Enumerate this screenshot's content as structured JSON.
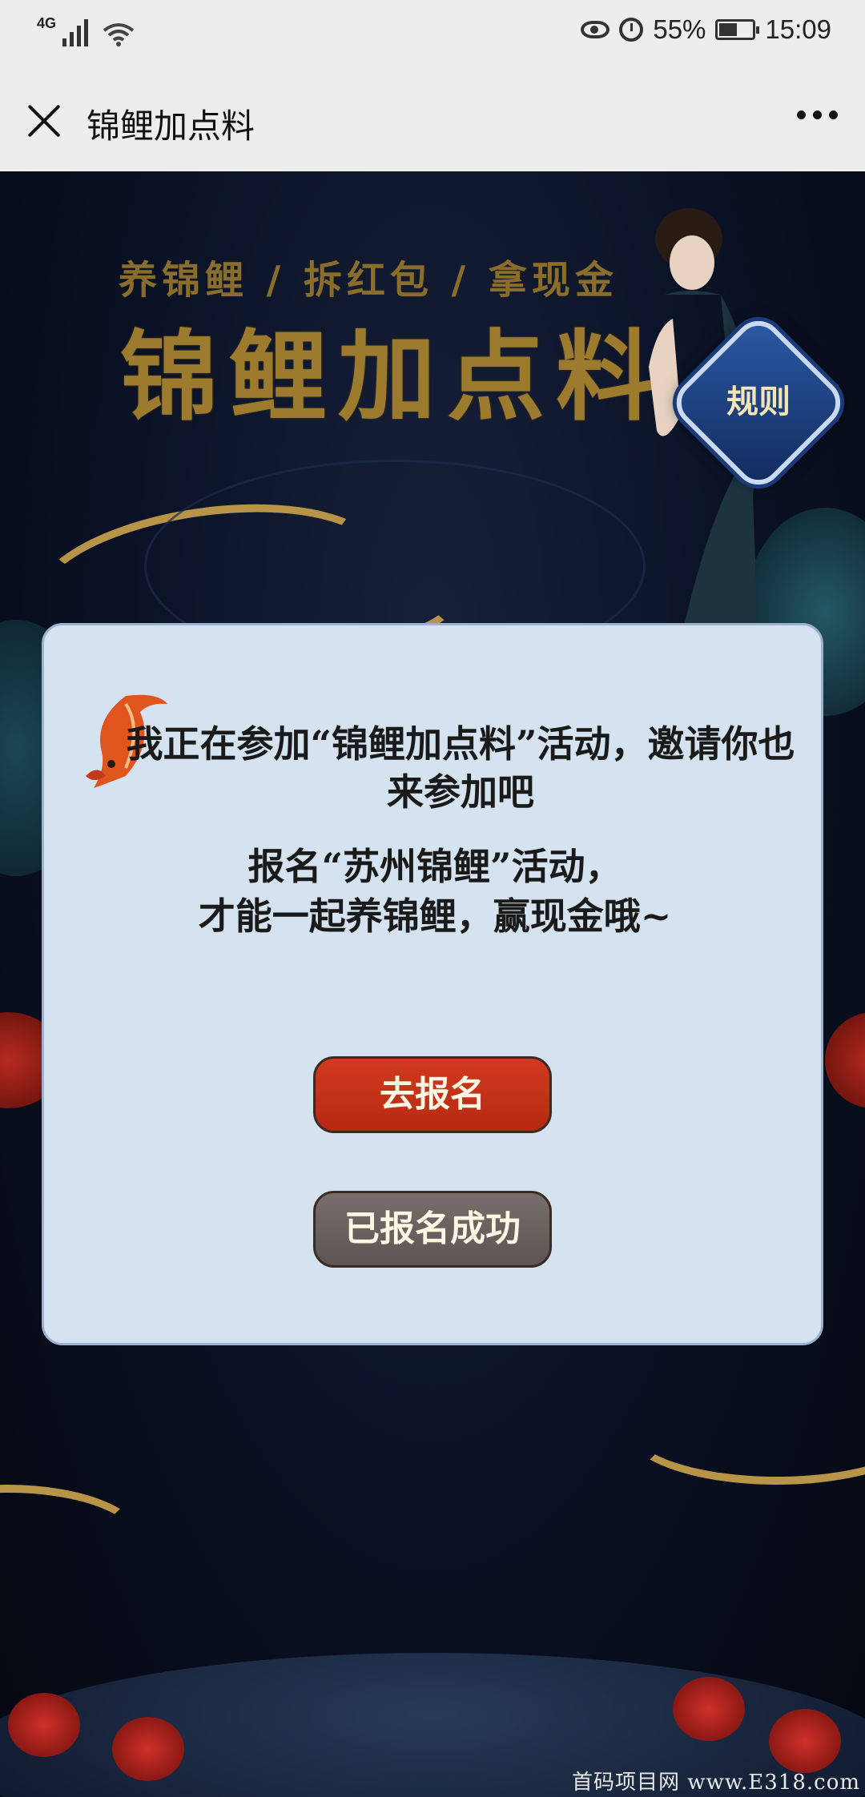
{
  "status_bar": {
    "network": "4G",
    "battery_percent_text": "55%",
    "battery_level": 0.55,
    "time": "15:09"
  },
  "title_bar": {
    "title": "锦鲤加点料"
  },
  "hero": {
    "tagline": "养锦鲤 / 拆红包 / 拿现金",
    "title": "锦鲤加点料",
    "rules_label": "规则"
  },
  "dialog": {
    "message_line1": "我正在参加“锦鲤加点料”活动，邀请你也来参加吧",
    "message_line2a": "报名“苏州锦鲤”活动，",
    "message_line2b": "才能一起养锦鲤，赢现金哦~",
    "signup_button": "去报名",
    "registered_button": "已报名成功"
  },
  "watermark": "首码项目网 www.E318.com",
  "colors": {
    "accent_red": "#c6341a",
    "gold": "#9c7b2e",
    "dialog_bg": "#d4e3ef"
  }
}
